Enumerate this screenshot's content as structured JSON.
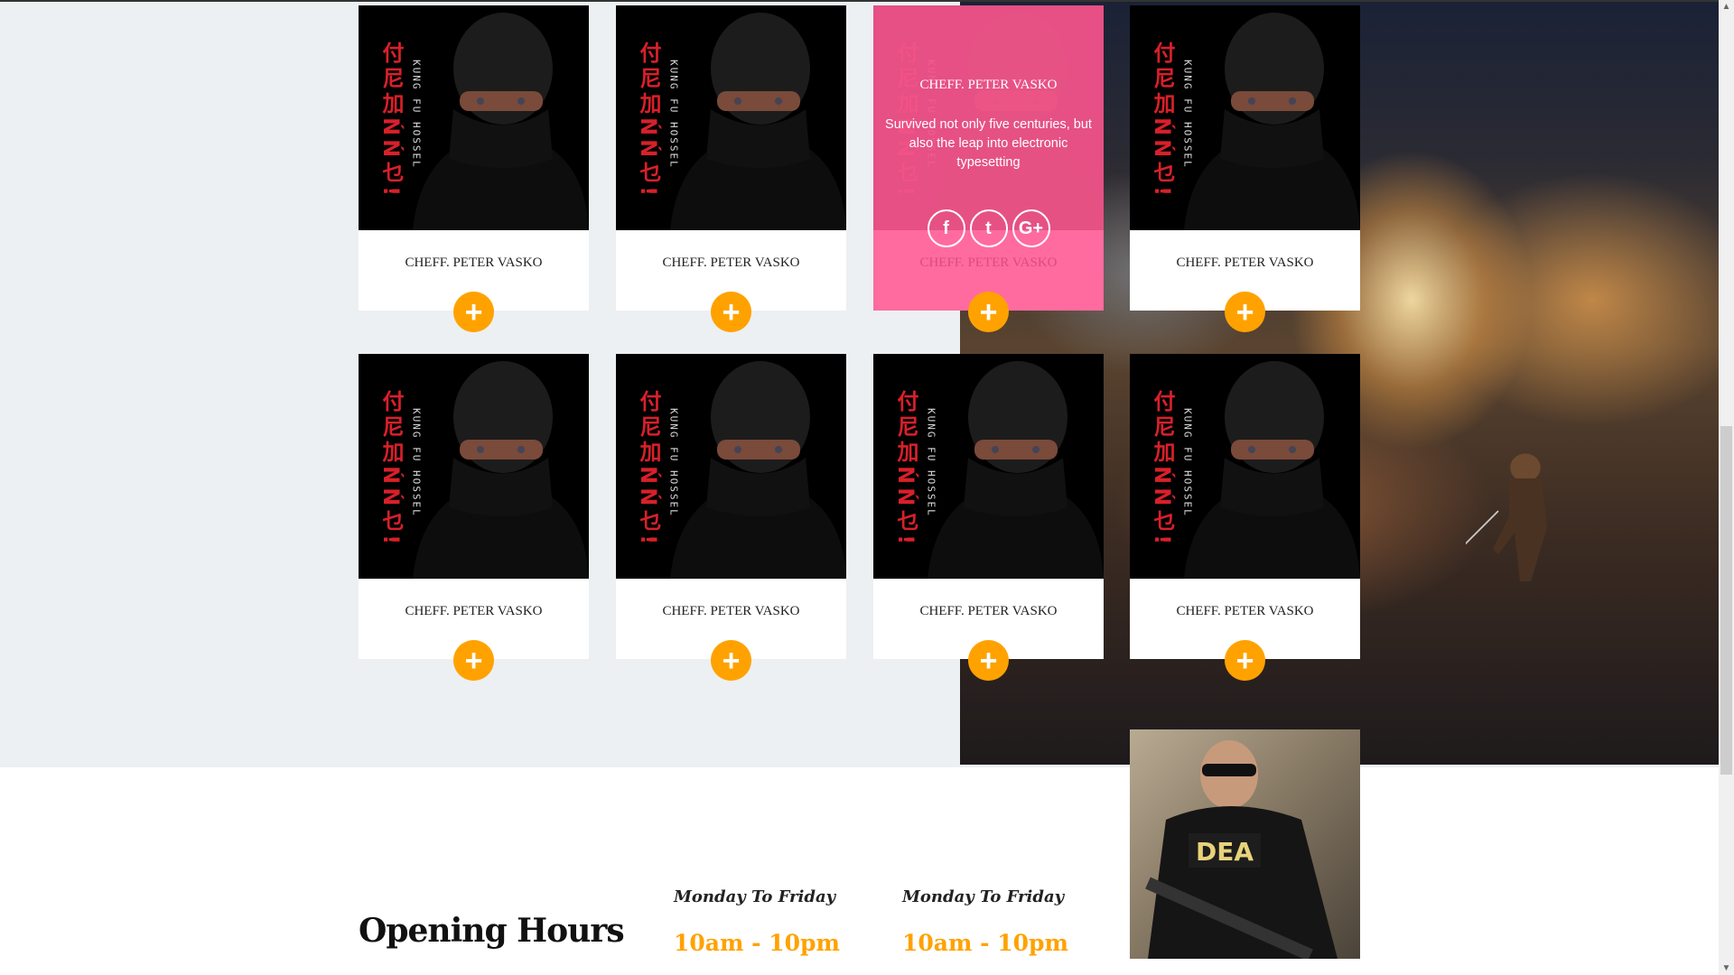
{
  "team": {
    "cards": [
      {
        "name": "CHEFF. PETER VASKO"
      },
      {
        "name": "CHEFF. PETER VASKO"
      },
      {
        "name": "CHEFF. PETER VASKO",
        "hover": true
      },
      {
        "name": "CHEFF. PETER VASKO"
      },
      {
        "name": "CHEFF. PETER VASKO"
      },
      {
        "name": "CHEFF. PETER VASKO"
      },
      {
        "name": "CHEFF. PETER VASKO"
      },
      {
        "name": "CHEFF. PETER VASKO"
      }
    ],
    "hover_title": "CHEFF. PETER VASKO",
    "hover_text": "Survived not only five centuries, but also the leap into electronic typesetting",
    "socials": [
      "f",
      "t",
      "G+"
    ],
    "plus_icon": "+",
    "image_caption": "KUNG FU HOSSEL",
    "image_glyphs": "付尼加ŃŃ乜!"
  },
  "hours": {
    "title": "Opening Hours",
    "columns": [
      {
        "days": "Monday To Friday",
        "time": "10am - 10pm"
      },
      {
        "days": "Monday To Friday",
        "time": "10am - 10pm"
      }
    ]
  },
  "dea_label": "DEA",
  "colors": {
    "accent": "#ffa200",
    "pink": "#ff5e96",
    "bg": "#ecf0f3"
  }
}
